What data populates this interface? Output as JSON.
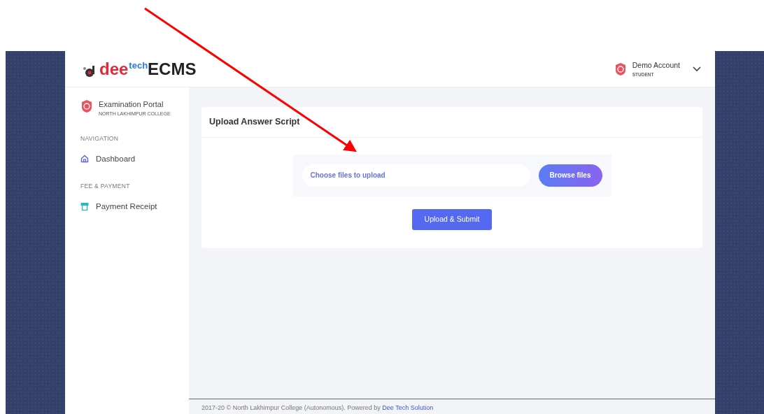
{
  "logo": {
    "part_1": "dee",
    "part_2": "tech",
    "part_3": "ECMS"
  },
  "user": {
    "name": "Demo Account",
    "role": "STUDENT"
  },
  "sidebar": {
    "portal_title": "Examination Portal",
    "portal_subtitle": "NORTH LAKHIMPUR COLLEGE",
    "sections": [
      {
        "heading": "NAVIGATION",
        "items": [
          {
            "label": "Dashboard",
            "kind": "home"
          }
        ]
      },
      {
        "heading": "FEE & PAYMENT",
        "items": [
          {
            "label": "Payment Receipt",
            "kind": "receipt"
          }
        ]
      }
    ]
  },
  "card": {
    "title": "Upload Answer Script",
    "file_field": {
      "placeholder": "Choose files to upload"
    },
    "browse_button": "Browse files",
    "submit_button": "Upload & Submit"
  },
  "footer": {
    "text": "2017-20 © North Lakhimpur College (Autonomous). Powered by",
    "link": "Dee Tech Solution"
  }
}
